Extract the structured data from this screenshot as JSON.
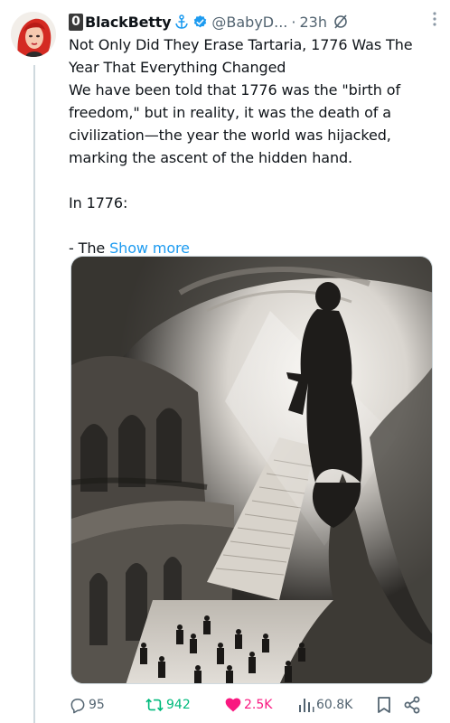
{
  "tweet": {
    "badge": "0",
    "display_name": "BlackBetty",
    "handle": "@BabyD...",
    "separator": "·",
    "time": "23h",
    "body": {
      "line1": "Not Only Did They Erase Tartaria, 1776 Was The Year That Everything Changed",
      "line2": "We have been told that 1776 was the \"birth of freedom,\" but in reality, it was the death of a civilization—the year the world was hijacked, marking the ascent of the hidden hand.",
      "line3": "In 1776:",
      "line4_prefix": "- The",
      "show_more": "Show more"
    }
  },
  "actions": {
    "replies": "95",
    "reposts": "942",
    "likes": "2.5K",
    "views": "60.8K"
  },
  "icons": {
    "anchor": "anchor-icon",
    "verified": "verified-badge-icon",
    "grok": "grok-icon",
    "more": "more-options-icon",
    "reply": "reply-icon",
    "repost": "repost-icon",
    "like": "heart-icon",
    "views": "views-icon",
    "bookmark": "bookmark-icon",
    "share": "share-icon"
  },
  "colors": {
    "accent": "#1d9bf0",
    "repost": "#00ba7c",
    "like": "#f91880",
    "muted": "#536471"
  }
}
